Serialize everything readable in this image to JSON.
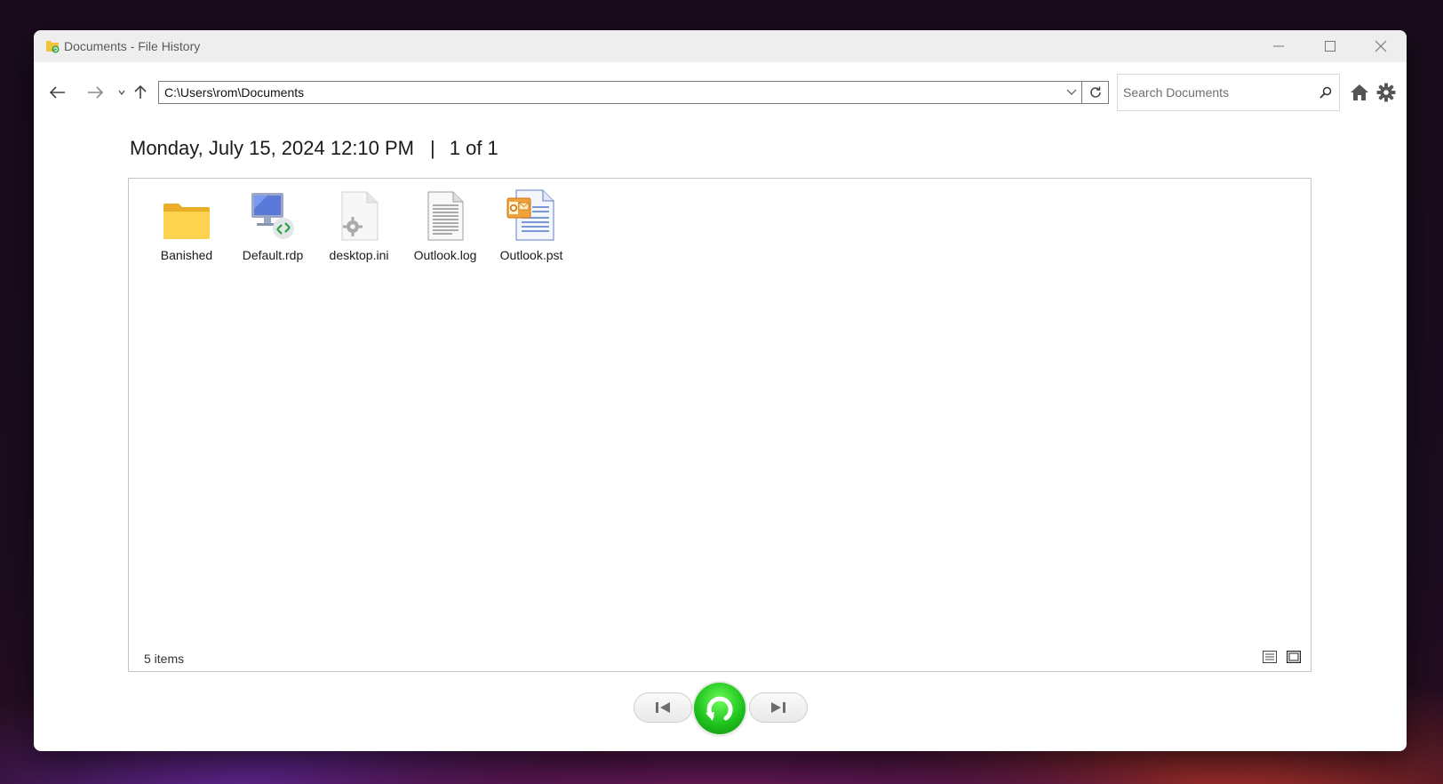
{
  "window": {
    "title": "Documents - File History",
    "controls": {
      "minimize": "minimize",
      "maximize": "maximize",
      "close": "close"
    }
  },
  "toolbar": {
    "address": "C:\\Users\\rom\\Documents",
    "search_placeholder": "Search Documents"
  },
  "snapshot": {
    "date": "Monday, July 15, 2024 12:10 PM",
    "separator": "|",
    "position": "1 of 1"
  },
  "files": [
    {
      "name": "Banished",
      "icon": "folder-icon"
    },
    {
      "name": "Default.rdp",
      "icon": "remote-desktop-icon"
    },
    {
      "name": "desktop.ini",
      "icon": "settings-file-icon"
    },
    {
      "name": "Outlook.log",
      "icon": "text-file-icon"
    },
    {
      "name": "Outlook.pst",
      "icon": "outlook-data-file-icon"
    }
  ],
  "status": {
    "items": "5 items"
  },
  "colors": {
    "accent_green": "#1fc41c",
    "folder_yellow": "#f8c93a"
  }
}
